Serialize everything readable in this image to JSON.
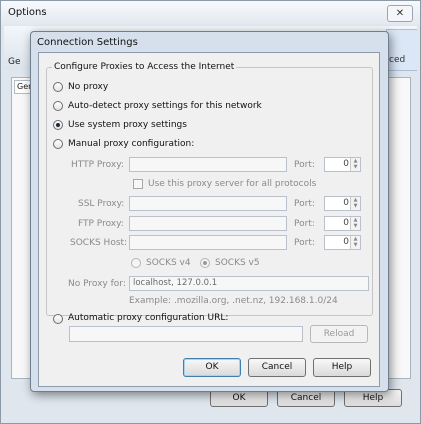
{
  "outer_window": {
    "title": "Options",
    "close_glyph": "✕",
    "toolbar_fragments": [
      "Ge",
      "ced"
    ],
    "side_tab_fragment": "Gen",
    "buttons": {
      "ok": "OK",
      "cancel": "Cancel",
      "help": "Help"
    }
  },
  "dialog": {
    "title": "Connection Settings",
    "group_title": "Configure Proxies to Access the Internet",
    "options": {
      "no_proxy": "No proxy",
      "auto_detect": "Auto-detect proxy settings for this network",
      "system": "Use system proxy settings",
      "manual": "Manual proxy configuration:",
      "auto_url": "Automatic proxy configuration URL:"
    },
    "selected_option": "system",
    "manual": {
      "http_label": "HTTP Proxy:",
      "http_value": "",
      "port_label": "Port:",
      "http_port": "0",
      "use_same_label": "Use this proxy server for all protocols",
      "ssl_label": "SSL Proxy:",
      "ssl_value": "",
      "ssl_port": "0",
      "ftp_label": "FTP Proxy:",
      "ftp_value": "",
      "ftp_port": "0",
      "socks_label": "SOCKS Host:",
      "socks_value": "",
      "socks_port": "0",
      "socks_v4": "SOCKS v4",
      "socks_v5": "SOCKS v5",
      "socks_selected": "v5",
      "no_proxy_label": "No Proxy for:",
      "no_proxy_value": "localhost, 127.0.0.1",
      "example": "Example: .mozilla.org, .net.nz, 192.168.1.0/24"
    },
    "auto_url_value": "",
    "reload_label": "Reload",
    "buttons": {
      "ok": "OK",
      "cancel": "Cancel",
      "help": "Help"
    }
  },
  "colors": {
    "dialog_frame": "#d5e0ec",
    "body": "#f0f0f0",
    "default_button_border": "#3c7fb1"
  }
}
